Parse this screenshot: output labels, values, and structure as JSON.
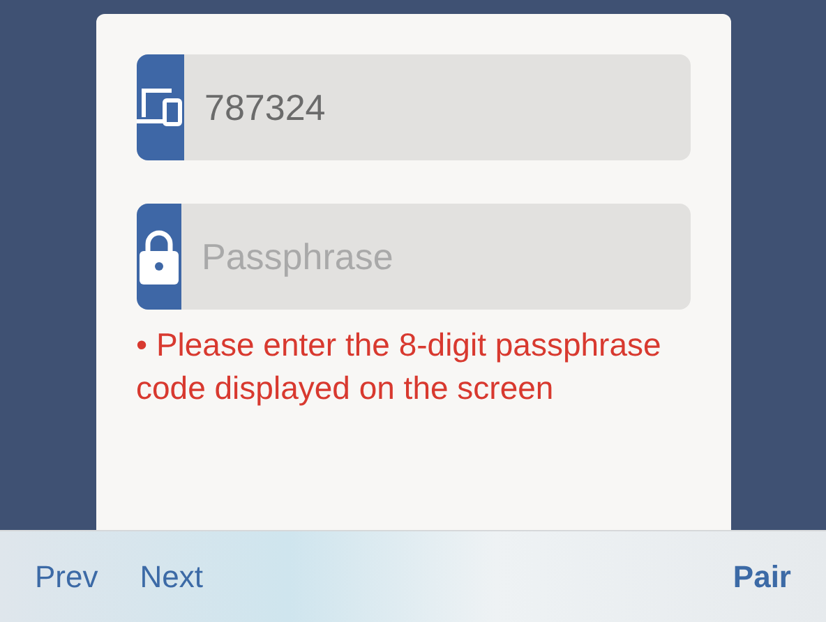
{
  "fields": [
    {
      "kind": "device",
      "value": "787324"
    },
    {
      "kind": "lock",
      "placeholder": "Passphrase"
    }
  ],
  "error": "• Please enter the 8-digit passphrase code displayed on the screen",
  "toolbar": {
    "prev": "Prev",
    "next": "Next",
    "pair": "Pair"
  }
}
